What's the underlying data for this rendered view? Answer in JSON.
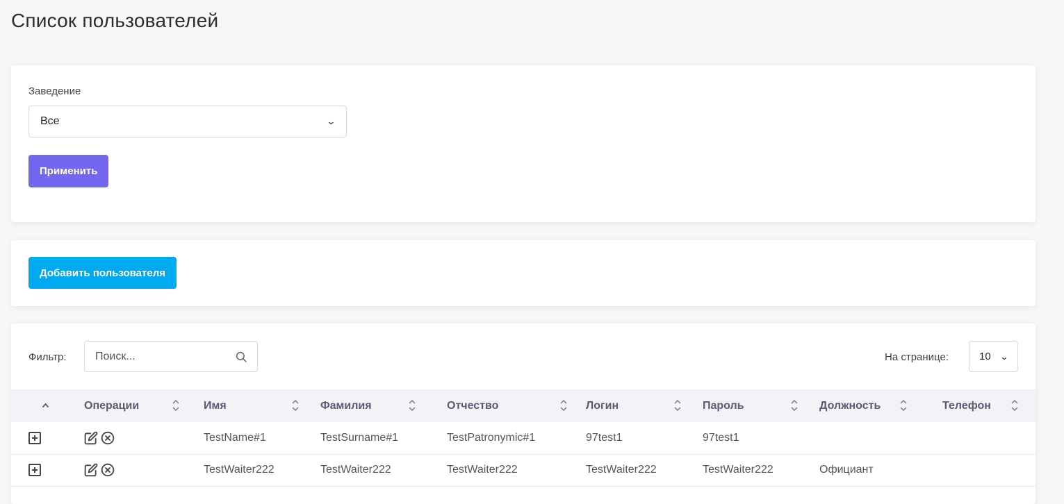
{
  "page": {
    "title": "Список пользователей"
  },
  "filter_card": {
    "label": "Заведение",
    "select_value": "Все",
    "apply_label": "Применить"
  },
  "add_card": {
    "add_label": "Добавить пользователя"
  },
  "table_card": {
    "filter_label": "Фильтр:",
    "search_placeholder": "Поиск...",
    "per_page_label": "На странице:",
    "per_page_value": "10",
    "columns": [
      "Операции",
      "Имя",
      "Фамилия",
      "Отчество",
      "Логин",
      "Пароль",
      "Должность",
      "Телефон"
    ],
    "rows": [
      {
        "name": "TestName#1",
        "surname": "TestSurname#1",
        "patronymic": "TestPatronymic#1",
        "login": "97test1",
        "password": "97test1",
        "position": "",
        "phone": ""
      },
      {
        "name": "TestWaiter222",
        "surname": "TestWaiter222",
        "patronymic": "TestWaiter222",
        "login": "TestWaiter222",
        "password": "TestWaiter222",
        "position": "Официант",
        "phone": ""
      }
    ]
  },
  "colors": {
    "primary": "#7367f0",
    "info": "#00aaf0",
    "header_bg": "#f3f2f7"
  }
}
